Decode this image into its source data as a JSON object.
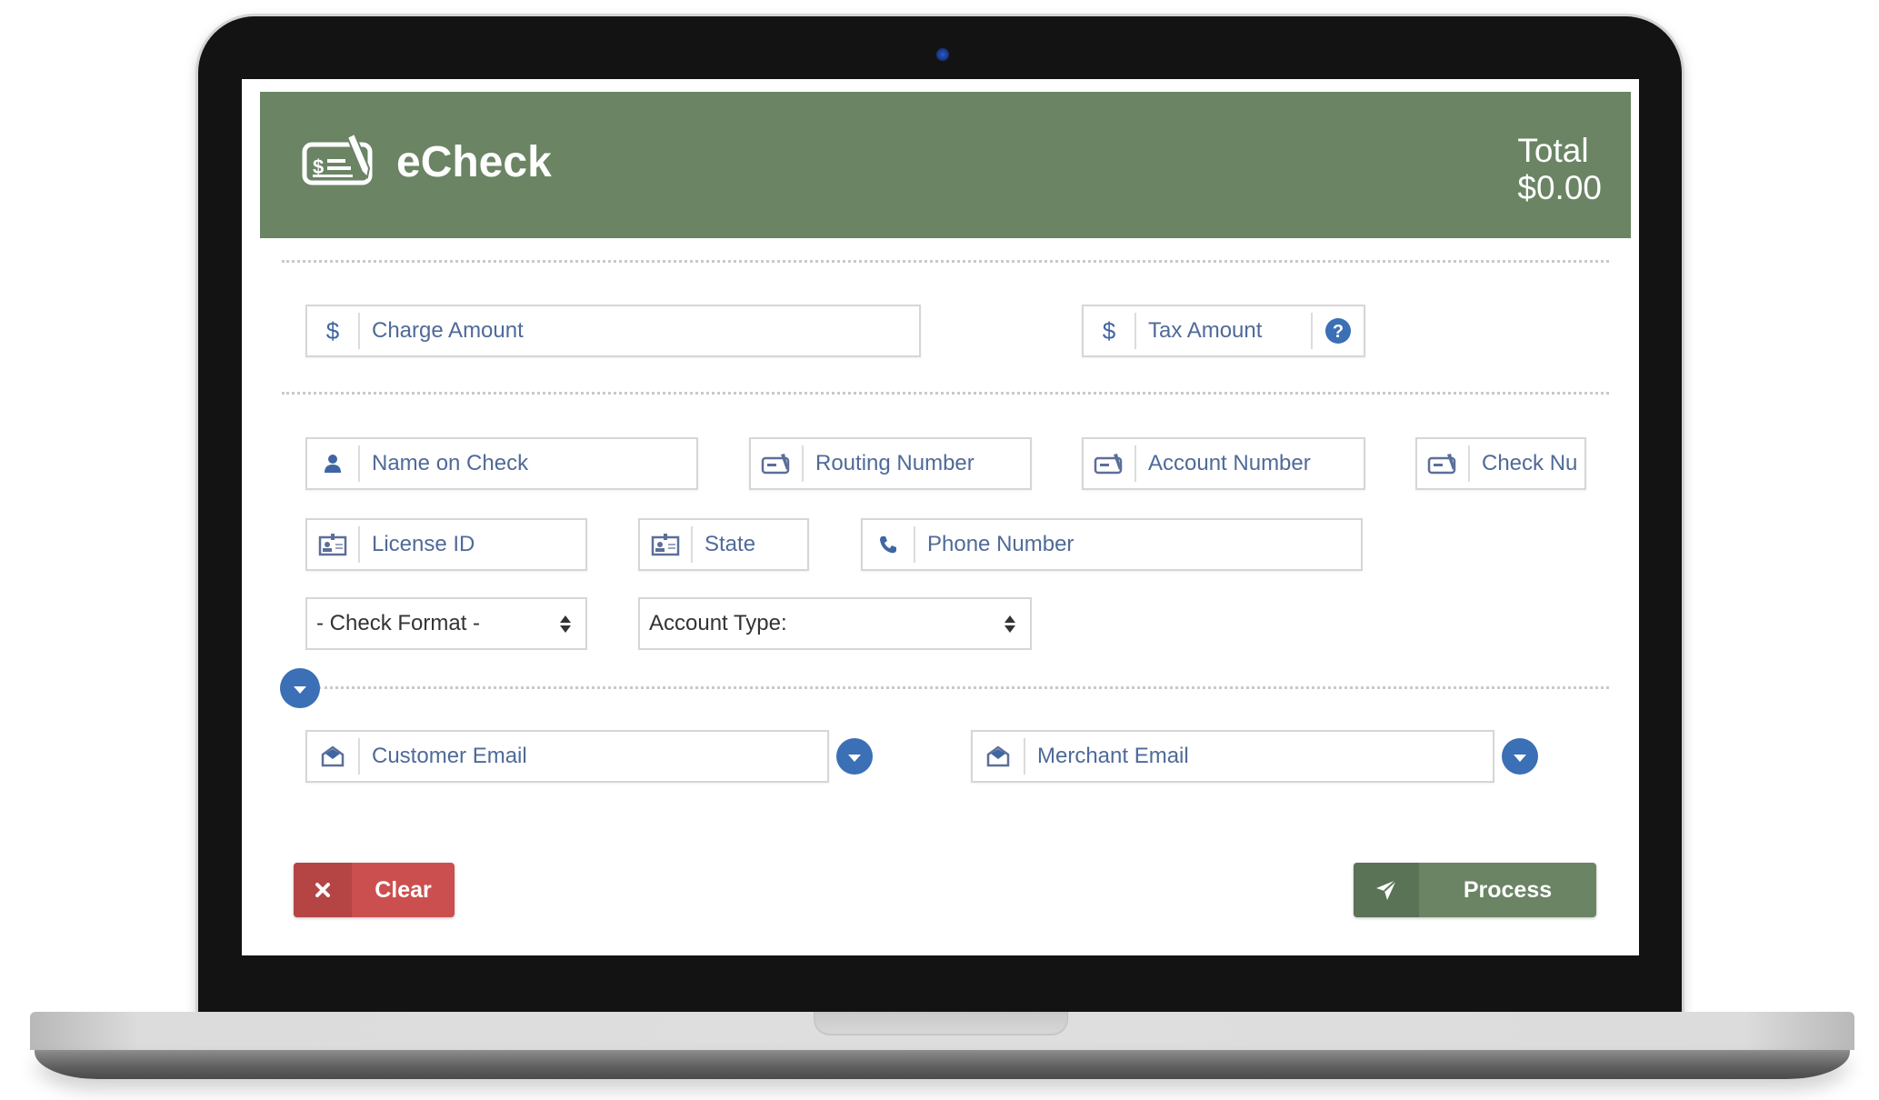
{
  "header": {
    "icon": "check-pen-icon",
    "title": "eCheck",
    "total_label": "Total",
    "total_value": "$0.00",
    "color": "#6a8464"
  },
  "amounts": {
    "charge": {
      "icon": "dollar-icon",
      "placeholder": "Charge Amount"
    },
    "tax": {
      "icon": "dollar-icon",
      "placeholder": "Tax Amount",
      "help_icon": "question-circle-icon"
    }
  },
  "check_info": {
    "name": {
      "icon": "user-icon",
      "placeholder": "Name on Check"
    },
    "routing": {
      "icon": "check-icon",
      "placeholder": "Routing Number"
    },
    "account": {
      "icon": "check-icon",
      "placeholder": "Account Number"
    },
    "check_number": {
      "icon": "check-icon",
      "placeholder": "Check Nu"
    },
    "license": {
      "icon": "id-card-icon",
      "placeholder": "License ID"
    },
    "state": {
      "icon": "id-card-icon",
      "placeholder": "State"
    },
    "phone": {
      "icon": "phone-icon",
      "placeholder": "Phone Number"
    },
    "check_format": {
      "selected": "- Check Format -"
    },
    "account_type": {
      "selected": "Account Type:"
    }
  },
  "emails": {
    "customer": {
      "icon": "envelope-open-icon",
      "placeholder": "Customer Email"
    },
    "merchant": {
      "icon": "envelope-open-icon",
      "placeholder": "Merchant Email"
    }
  },
  "actions": {
    "clear_label": "Clear",
    "clear_icon": "times-icon",
    "clear_color": "#cc4f4f",
    "process_label": "Process",
    "process_icon": "paper-plane-icon",
    "process_color": "#6a8464"
  },
  "accent": "#3b6fb6"
}
